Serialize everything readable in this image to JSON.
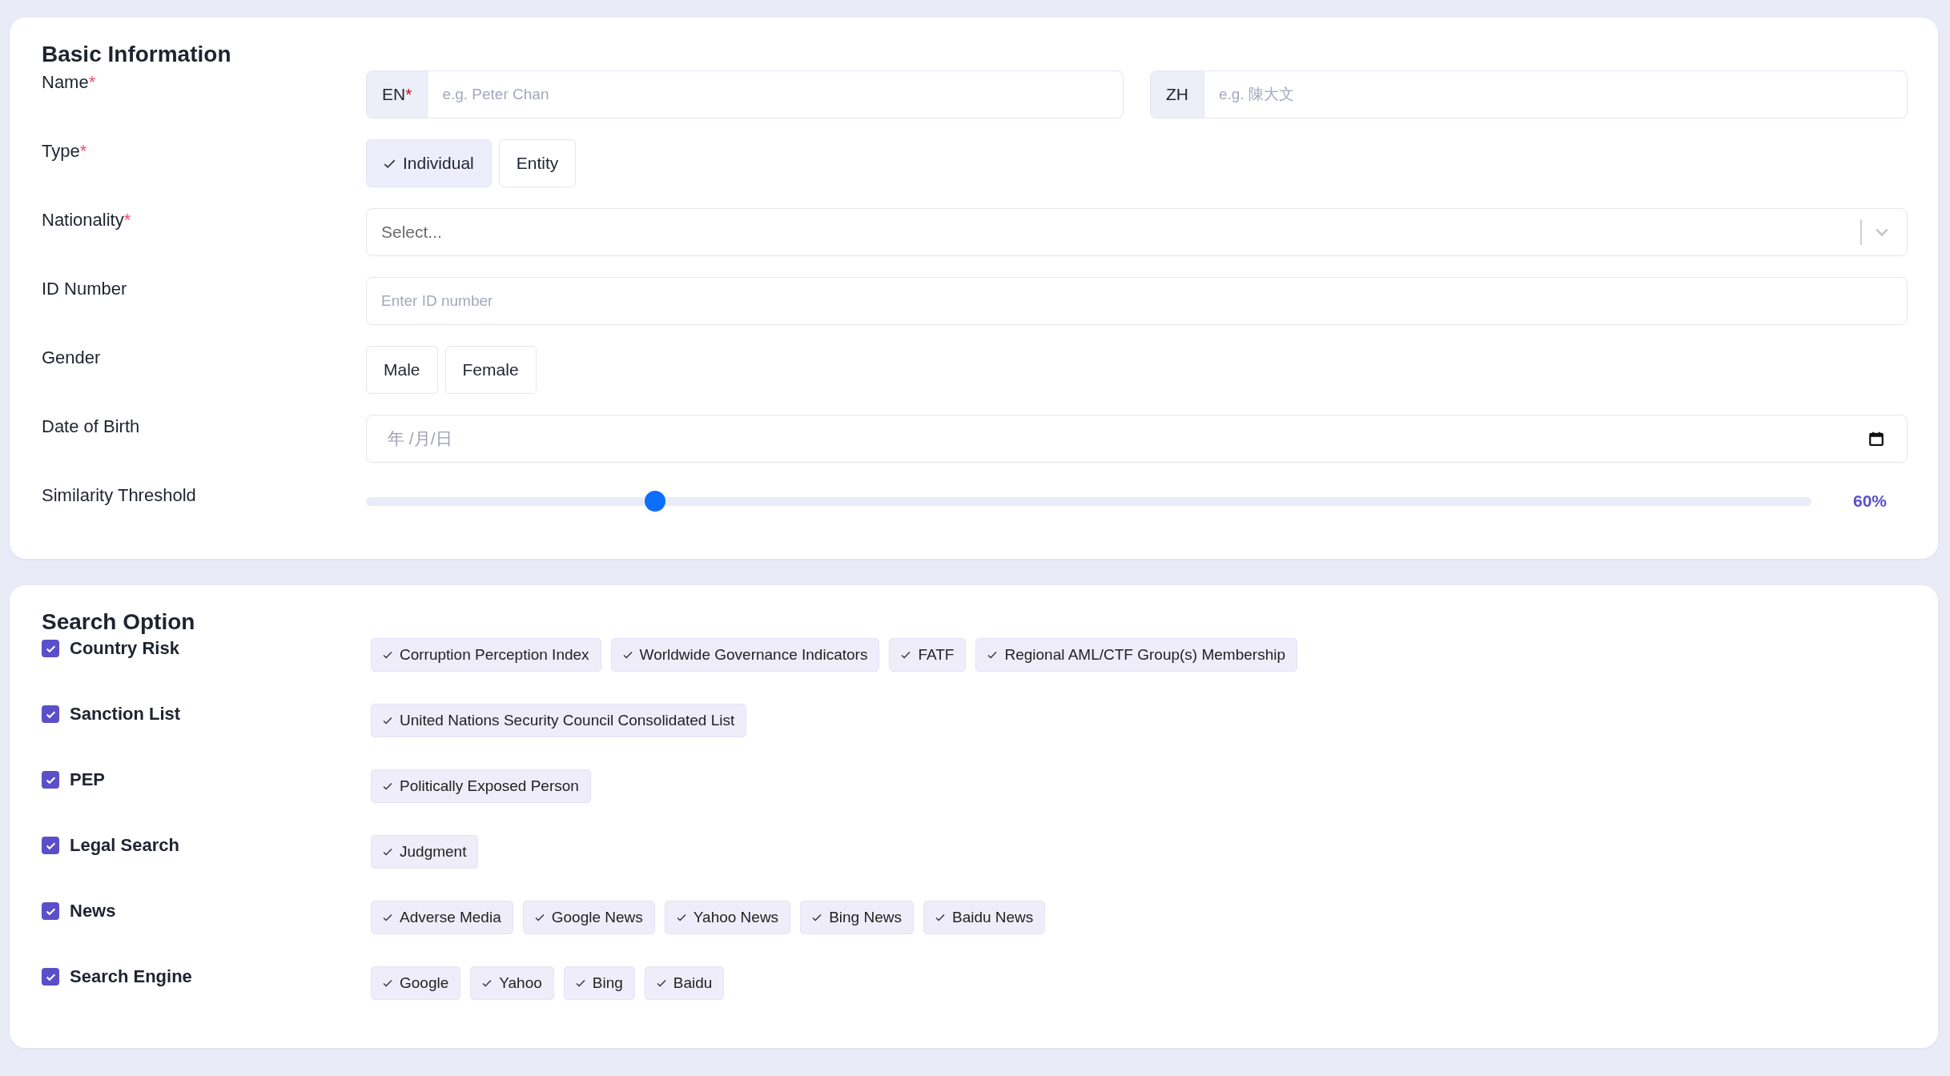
{
  "basic_information": {
    "title": "Basic Information",
    "name": {
      "label": "Name",
      "marker": "*",
      "inputs": [
        {
          "prefix": "EN",
          "marker": "*",
          "placeholder": "e.g. Peter Chan"
        },
        {
          "prefix": "ZH",
          "placeholder": "e.g. 陳大文"
        }
      ]
    },
    "type": {
      "label": "Type",
      "marker": "*",
      "options": [
        {
          "label": "Individual",
          "selected": true
        },
        {
          "label": "Entity",
          "selected": false
        }
      ]
    },
    "nationality": {
      "label": "Nationality",
      "marker": "*",
      "placeholder": "Select..."
    },
    "id_number": {
      "label": "ID Number",
      "placeholder": "Enter ID number"
    },
    "gender": {
      "label": "Gender",
      "options": [
        {
          "label": "Male",
          "selected": false
        },
        {
          "label": "Female",
          "selected": false
        }
      ]
    },
    "date_of_birth": {
      "label": "Date of Birth",
      "placeholder": "年 /月/日"
    },
    "similarity_threshold": {
      "label": "Similarity Threshold",
      "level": 0.2,
      "reading": "60%"
    }
  },
  "search_option": {
    "title": "Search Option",
    "groups": [
      {
        "label": "Country Risk",
        "checked": true,
        "sources": [
          {
            "label": "Corruption Perception Index",
            "selected": true
          },
          {
            "label": "Worldwide Governance Indicators",
            "selected": true
          },
          {
            "label": "FATF",
            "selected": true
          },
          {
            "label": "Regional AML/CTF Group(s) Membership",
            "selected": true
          }
        ]
      },
      {
        "label": "Sanction List",
        "checked": true,
        "sources": [
          {
            "label": "United Nations Security Council Consolidated List",
            "selected": true
          }
        ]
      },
      {
        "label": "PEP",
        "checked": true,
        "sources": [
          {
            "label": "Politically Exposed Person",
            "selected": true
          }
        ]
      },
      {
        "label": "Legal Search",
        "checked": true,
        "sources": [
          {
            "label": "Judgment",
            "selected": true
          }
        ]
      },
      {
        "label": "News",
        "checked": true,
        "sources": [
          {
            "label": "Adverse Media",
            "selected": true
          },
          {
            "label": "Google News",
            "selected": true
          },
          {
            "label": "Yahoo News",
            "selected": true
          },
          {
            "label": "Bing News",
            "selected": true
          },
          {
            "label": "Baidu News",
            "selected": true
          }
        ]
      },
      {
        "label": "Search Engine",
        "checked": true,
        "sources": [
          {
            "label": "Google",
            "selected": true
          },
          {
            "label": "Yahoo",
            "selected": true
          },
          {
            "label": "Bing",
            "selected": true
          },
          {
            "label": "Baidu",
            "selected": true
          }
        ]
      }
    ]
  }
}
